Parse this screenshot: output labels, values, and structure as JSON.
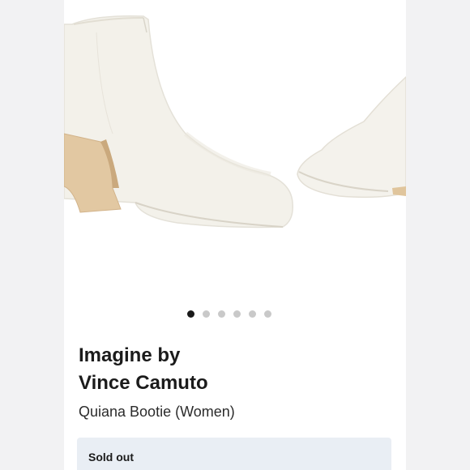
{
  "product": {
    "brand_line1": "Imagine by",
    "brand_line2": "Vince Camuto",
    "name": "Quiana Bootie (Women)",
    "image_alt": "White leather ankle bootie with wooden block heel"
  },
  "carousel": {
    "active_index": 0,
    "total": 6
  },
  "availability": {
    "status": "Sold out"
  },
  "colors": {
    "status_bg": "#e9eef4",
    "active_dot": "#1a1a1a",
    "inactive_dot": "#c9c9c9"
  }
}
